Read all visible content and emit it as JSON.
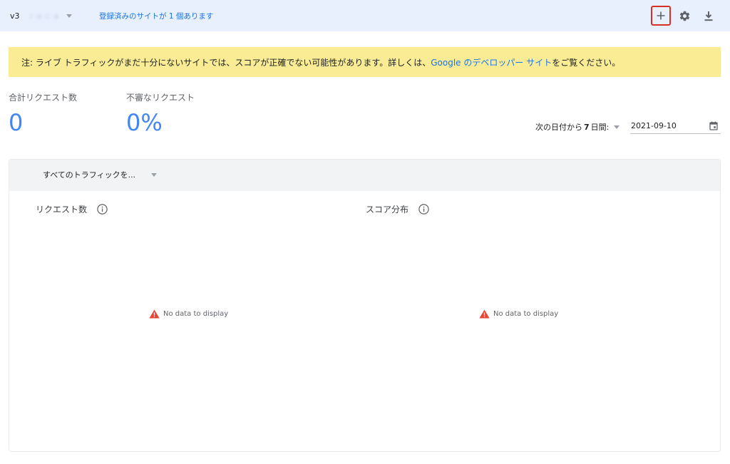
{
  "topbar": {
    "site_version": "v3",
    "site_name_blurred": "r·e·c·a",
    "site_count_label": "登録済みのサイトが 1 個あります"
  },
  "toolbar": {
    "add_icon": "plus-icon",
    "settings_icon": "gear-icon",
    "download_icon": "download-icon"
  },
  "notice": {
    "text_before": "注: ライブ トラフィックがまだ十分にないサイトでは、スコアが正確でない可能性があります。詳しくは、",
    "link_text": "Google のデベロッパー サイト",
    "text_after": "をご覧ください。"
  },
  "stats": {
    "total_requests": {
      "label": "合計リクエスト数",
      "value": "0"
    },
    "suspicious_requests": {
      "label": "不審なリクエスト",
      "value": "0%"
    }
  },
  "date_range": {
    "prefix": "次の日付から",
    "days": "7",
    "suffix": "日間:",
    "date": "2021-09-10"
  },
  "panel": {
    "traffic_filter": "すべてのトラフィックを...",
    "charts": [
      {
        "title": "リクエスト数",
        "empty_message": "No data to display"
      },
      {
        "title": "スコア分布",
        "empty_message": "No data to display"
      }
    ]
  },
  "colors": {
    "accent": "#1a73e8",
    "stat_blue": "#4285f4",
    "notice_bg": "#f9ec95",
    "topbar_bg": "#e8f0fe",
    "highlight_red": "#d93025",
    "warning_red": "#ea4335"
  }
}
